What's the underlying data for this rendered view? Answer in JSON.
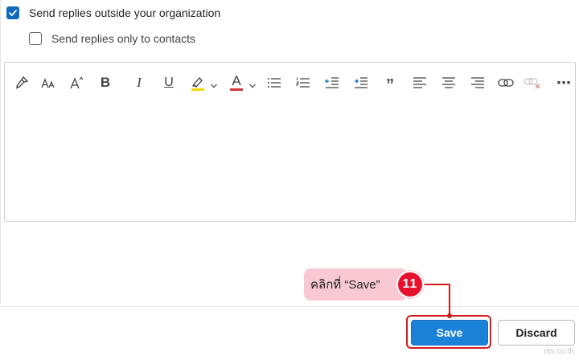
{
  "options": {
    "outside_org": {
      "label": "Send replies outside your organization",
      "checked": true
    },
    "contacts_only": {
      "label": "Send replies only to contacts",
      "checked": false
    }
  },
  "toolbar": {
    "icons": [
      "format-painter-icon",
      "font-size-icon",
      "grow-font-icon",
      "bold-icon",
      "italic-icon",
      "underline-icon",
      "highlight-icon",
      "font-color-icon",
      "bullets-icon",
      "numbering-icon",
      "decrease-indent-icon",
      "increase-indent-icon",
      "quote-icon",
      "align-left-icon",
      "align-center-icon",
      "align-right-icon",
      "insert-link-icon",
      "remove-link-icon",
      "more-options-icon"
    ],
    "bold_glyph": "B",
    "italic_glyph": "I",
    "underline_glyph": "U",
    "font_color_glyph": "A",
    "quote_glyph": "”",
    "more_glyph": "⋯",
    "highlight_color": "#f2d600",
    "font_color": "#d13438"
  },
  "callout": {
    "text": "คลิกที่ “Save”",
    "step": "11"
  },
  "buttons": {
    "save": "Save",
    "discard": "Discard"
  },
  "watermark": "nts.co.th",
  "colors": {
    "accent": "#0f6cbd",
    "save_button": "#1b82d8",
    "highlight_border": "#d01c1c",
    "badge": "#e8112d",
    "callout_bg": "#f8c9d3"
  }
}
